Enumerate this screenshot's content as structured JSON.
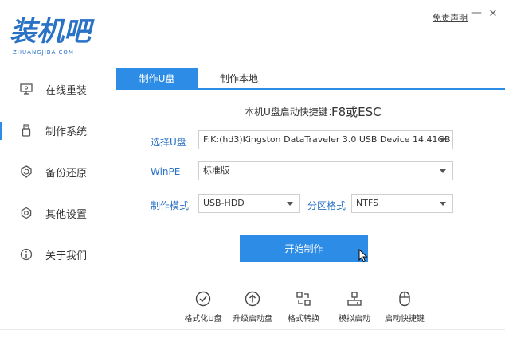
{
  "logo": {
    "main": "装机吧",
    "sub": "ZHUANGJIBA.COM"
  },
  "header": {
    "disclaimer": "免责声明",
    "minimize": "—",
    "close": "✕"
  },
  "sidebar": {
    "items": [
      {
        "label": "在线重装",
        "icon": "monitor-icon"
      },
      {
        "label": "制作系统",
        "icon": "usb-icon",
        "active": true
      },
      {
        "label": "备份还原",
        "icon": "backup-icon"
      },
      {
        "label": "其他设置",
        "icon": "gear-icon"
      },
      {
        "label": "关于我们",
        "icon": "info-icon"
      }
    ]
  },
  "tabs": [
    {
      "label": "制作U盘",
      "active": true
    },
    {
      "label": "制作本地",
      "active": false
    }
  ],
  "main": {
    "hotkey_label": "本机U盘启动快捷键：",
    "hotkey_value": "F8或ESC",
    "select_udisk_label": "选择U盘",
    "select_udisk_value": "F:K:(hd3)Kingston DataTraveler 3.0 USB Device 14.41GB",
    "winpe_label": "WinPE",
    "winpe_value": "标准版",
    "mode_label": "制作模式",
    "mode_value": "USB-HDD",
    "partition_label": "分区格式",
    "partition_value": "NTFS",
    "start_button": "开始制作"
  },
  "tools": [
    {
      "label": "格式化U盘",
      "icon": "check-circle-icon"
    },
    {
      "label": "升级启动盘",
      "icon": "upload-circle-icon"
    },
    {
      "label": "格式转换",
      "icon": "convert-icon"
    },
    {
      "label": "模拟启动",
      "icon": "simulate-icon"
    },
    {
      "label": "启动快捷键",
      "icon": "mouse-icon"
    }
  ],
  "colors": {
    "accent": "#2d8ce6",
    "label_blue": "#2a72c6"
  }
}
